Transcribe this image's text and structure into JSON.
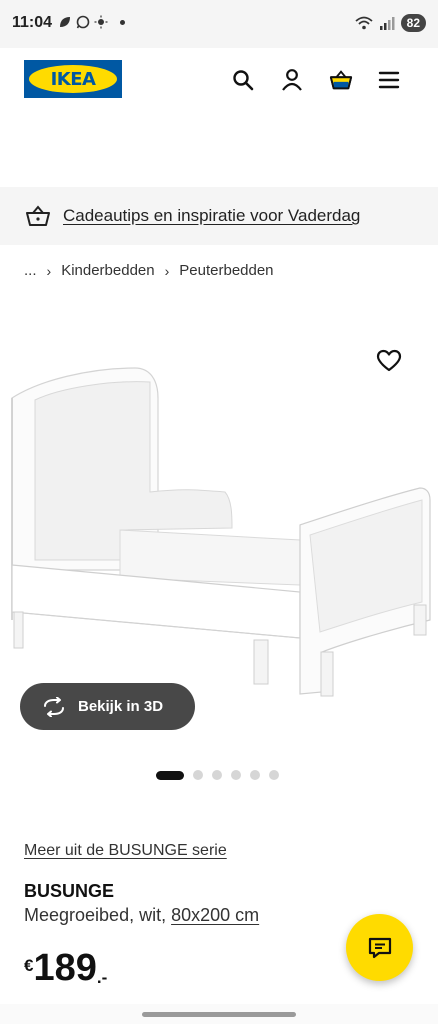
{
  "status_bar": {
    "time": "11:04",
    "battery": "82"
  },
  "header": {
    "logo_text": "IKEA",
    "icons": [
      "search-icon",
      "account-icon",
      "cart-icon",
      "menu-icon"
    ]
  },
  "promo": {
    "text": "Cadeautips en inspiratie voor Vaderdag",
    "icon": "basket-icon"
  },
  "breadcrumb": {
    "ellipsis": "...",
    "items": [
      "Kinderbedden",
      "Peuterbedden"
    ]
  },
  "gallery": {
    "view_3d_label": "Bekijk in 3D",
    "image_count": 6,
    "active_index": 0
  },
  "product": {
    "series_link": "Meer uit de BUSUNGE serie",
    "name": "BUSUNGE",
    "description": "Meegroeibed, wit, ",
    "size": "80x200 cm",
    "price_currency": "€",
    "price_amount": "189",
    "price_decimals": ".-"
  },
  "colors": {
    "brand_blue": "#0058a3",
    "brand_yellow": "#ffdb00",
    "button_dark": "#484848"
  }
}
